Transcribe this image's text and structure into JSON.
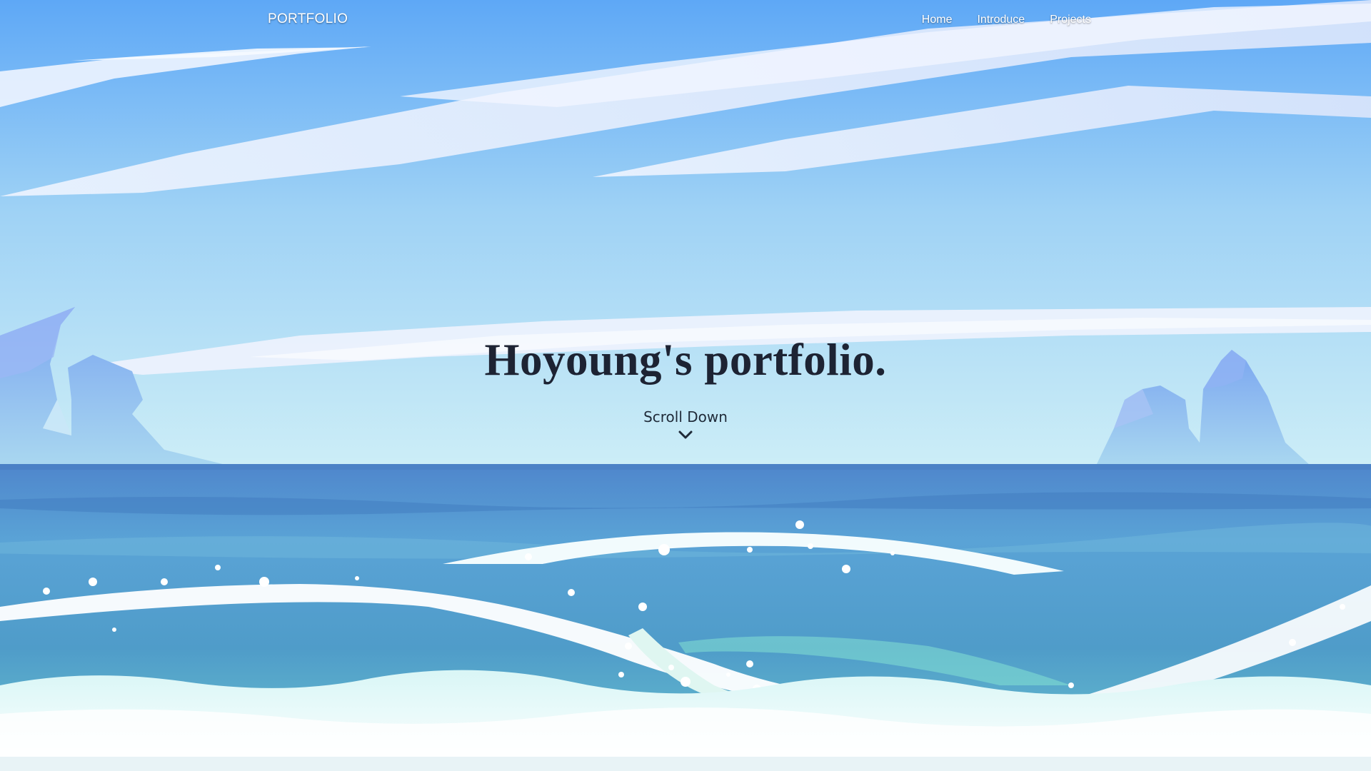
{
  "navbar": {
    "brand": "PORTFOLIO",
    "links": [
      {
        "label": "Home"
      },
      {
        "label": "Introduce"
      },
      {
        "label": "Projects"
      }
    ]
  },
  "hero": {
    "title": "Hoyoung's portfolio.",
    "scroll_label": "Scroll Down",
    "scroll_icon": "chevron-down-icon"
  },
  "colors": {
    "sky_top": "#5da9f5",
    "sky_bottom": "#c8eaf6",
    "sea": "#4a8fcf",
    "foam": "#f3fbfd",
    "headline_text": "#1d2333"
  }
}
